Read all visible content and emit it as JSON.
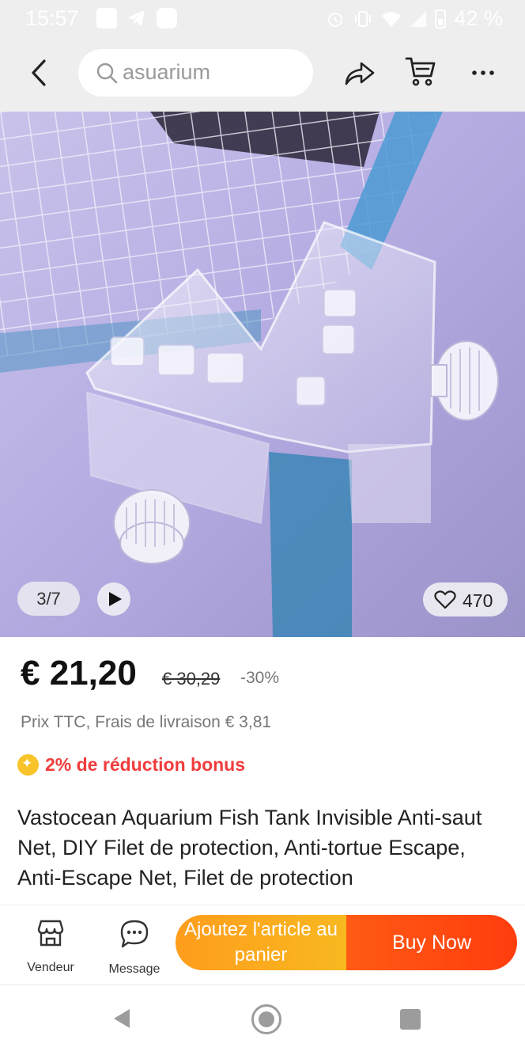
{
  "status_bar": {
    "time": "15:57",
    "battery": "42 %",
    "icons": [
      "square-notification-icon",
      "telegram-icon",
      "app-notification-icon",
      "alarm-icon",
      "vibrate-icon",
      "wifi-icon",
      "signal-icon",
      "battery-icon"
    ]
  },
  "header": {
    "search_value": "asuarium",
    "icons": [
      "back-arrow-icon",
      "search-icon",
      "share-icon",
      "cart-icon",
      "more-icon"
    ]
  },
  "gallery": {
    "counter": "3/7",
    "wishlist_count": "470"
  },
  "price": {
    "current": "€ 21,20",
    "original": "€ 30,29",
    "discount": "-30%",
    "note": "Prix TTC, Frais de livraison € 3,81"
  },
  "bonus": {
    "text": "2% de réduction bonus",
    "color": "#f03c3c"
  },
  "product": {
    "title": "Vastocean Aquarium Fish Tank Invisible Anti-saut Net, DIY Filet de protection, Anti-tortue Escape, Anti-Escape Net, Filet de protection"
  },
  "actions": {
    "vendor_label": "Vendeur",
    "message_label": "Message",
    "add_to_cart_label": "Ajoutez l'article au panier",
    "buy_now_label": "Buy Now",
    "add_to_cart_color": "#ff9d1c",
    "buy_now_color": "#ff3d0d"
  }
}
